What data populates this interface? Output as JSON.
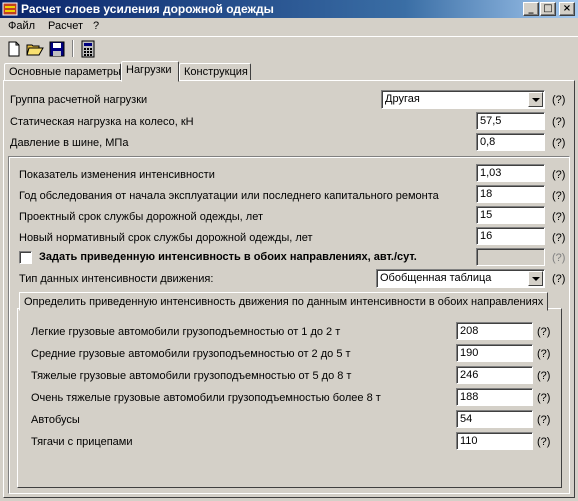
{
  "window": {
    "title": "Расчет слоев усиления дорожной одежды"
  },
  "menu": [
    "Файл",
    "Расчет",
    "?"
  ],
  "tabs": [
    {
      "label": "Основные параметры",
      "active": false
    },
    {
      "label": "Нагрузки",
      "active": true
    },
    {
      "label": "Конструкция",
      "active": false
    }
  ],
  "help_mark": "(?)",
  "load": {
    "group_label": "Группа расчетной нагрузки",
    "group_value": "Другая",
    "static_label": "Статическая нагрузка на колесо, кН",
    "static_value": "57,5",
    "pressure_label": "Давление в шине, МПа",
    "pressure_value": "0,8"
  },
  "intensity": {
    "rate_label": "Показатель изменения интенсивности",
    "rate_value": "1,03",
    "survey_year_label": "Год обследования от начала эксплуатации или последнего капитального ремонта",
    "survey_year_value": "18",
    "design_life_label": "Проектный срок службы дорожной одежды, лет",
    "design_life_value": "15",
    "new_life_label": "Новый нормативный срок службы дорожной одежды, лет",
    "new_life_value": "16",
    "set_reduced_label": "Задать приведенную интенсивность в обоих направлениях, авт./сут.",
    "set_reduced_checked": false,
    "set_reduced_value": "",
    "data_type_label": "Тип данных интенсивности движения:",
    "data_type_value": "Обобщенная таблица"
  },
  "subtab": {
    "label": "Определить приведенную интенсивность движения по данным интенсивности в обоих направлениях"
  },
  "vehicles": [
    {
      "label": "Легкие грузовые автомобили грузоподъемностью от 1 до 2 т",
      "value": "208"
    },
    {
      "label": "Средние грузовые автомобили грузоподъемностью от 2 до 5 т",
      "value": "190"
    },
    {
      "label": "Тяжелые грузовые автомобили грузоподъемностью от 5 до 8 т",
      "value": "246"
    },
    {
      "label": "Очень тяжелые грузовые автомобили грузоподъемностью более 8 т",
      "value": "188"
    },
    {
      "label": "Автобусы",
      "value": "54"
    },
    {
      "label": "Тягачи с прицепами",
      "value": "110"
    }
  ],
  "icons": [
    "new-document-icon",
    "open-folder-icon",
    "save-icon",
    "calculator-icon"
  ]
}
